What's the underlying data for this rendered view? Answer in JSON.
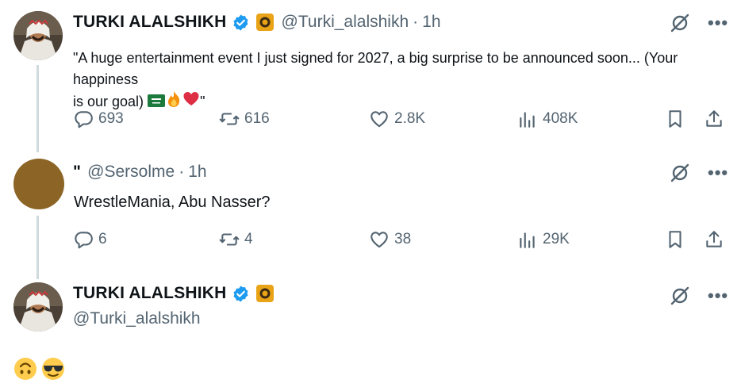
{
  "tweet1": {
    "name": "TURKI ALALSHIKH",
    "handle": "@Turki_alalshikh",
    "separator": "·",
    "time": "1h",
    "text_line1": "\"A huge entertainment event I just signed for 2027, a big surprise to be announced soon... (Your happiness",
    "text_line2": "is our goal)",
    "text_end": "\"",
    "replies": "693",
    "reposts": "616",
    "likes": "2.8K",
    "views": "408K"
  },
  "tweet2": {
    "name_mark": "\"",
    "handle": "@Sersolme",
    "separator": "·",
    "time": "1h",
    "text": "WrestleMania, Abu Nasser?",
    "replies": "6",
    "reposts": "4",
    "likes": "38",
    "views": "29K"
  },
  "tweet3": {
    "name": "TURKI ALALSHIKH",
    "handle": "@Turki_alalshikh"
  },
  "colors": {
    "text": "#0f1419",
    "secondary": "#536471",
    "verified": "#1d9bf0",
    "thread_line": "#cfd9de"
  },
  "icons": [
    "verified-badge-icon",
    "affiliate-badge-icon",
    "grok-icon",
    "more-icon",
    "reply-icon",
    "repost-icon",
    "like-icon",
    "views-icon",
    "bookmark-icon",
    "share-icon",
    "saudi-flag-emoji",
    "fire-emoji",
    "heart-emoji",
    "upside-down-face-emoji",
    "sunglasses-face-emoji"
  ]
}
